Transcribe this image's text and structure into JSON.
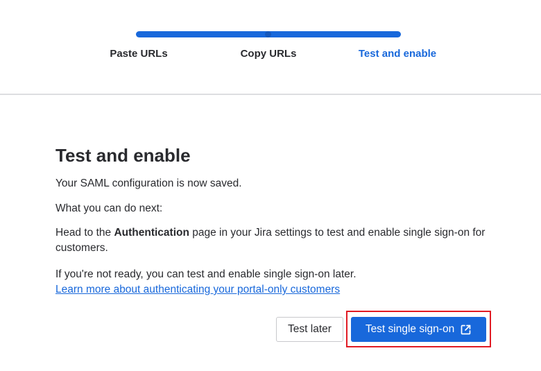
{
  "progress": {
    "steps": [
      {
        "label": "Paste URLs",
        "state": "complete"
      },
      {
        "label": "Copy URLs",
        "state": "complete"
      },
      {
        "label": "Test and enable",
        "state": "current"
      }
    ],
    "completion": 1.0
  },
  "content": {
    "title": "Test and enable",
    "saved_message": "Your SAML configuration is now saved.",
    "next_heading": "What you can do next:",
    "instruction_prefix": "Head to the ",
    "instruction_bold": "Authentication",
    "instruction_suffix": " page in your Jira settings to test and enable single sign-on for customers.",
    "not_ready_text": "If you're not ready, you can test and enable single sign-on later.",
    "learn_more_link": "Learn more about authenticating your portal-only customers"
  },
  "actions": {
    "test_later_label": "Test later",
    "test_sso_label": "Test single sign-on",
    "test_sso_icon": "external-link-icon"
  },
  "colors": {
    "primary": "#1868db",
    "text": "#292a2e",
    "highlight": "#e01b24"
  }
}
